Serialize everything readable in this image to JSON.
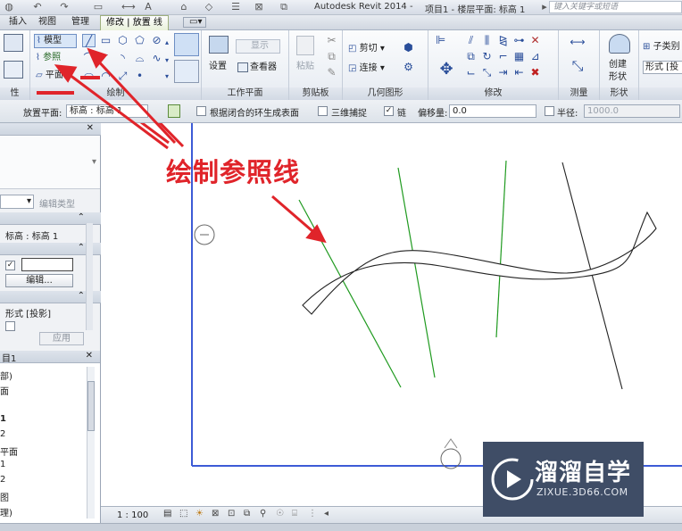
{
  "titlebar": {
    "app_title": "Autodesk Revit 2014 -",
    "doc_title": "项目1 - 楼层平面: 标高 1",
    "search_placeholder": "键入关键字或短语"
  },
  "tabs": [
    {
      "label": "插入",
      "active": false
    },
    {
      "label": "视图",
      "active": false
    },
    {
      "label": "管理",
      "active": false
    },
    {
      "label": "修改 | 放置 线",
      "active": true
    }
  ],
  "ribbon": {
    "props_panel_label": "性",
    "draw_panel_label": "绘制",
    "draw": {
      "model": "模型",
      "reference": "参照",
      "plane": "平面"
    },
    "workplane": {
      "label": "工作平面",
      "set": "设置",
      "show": "显示",
      "viewer": "查看器"
    },
    "clipboard": {
      "label": "剪贴板",
      "paste": "粘贴"
    },
    "geometry": {
      "label": "几何图形",
      "cut": "剪切",
      "join": "连接"
    },
    "modify": {
      "label": "修改"
    },
    "measure": {
      "label": "测量"
    },
    "form": {
      "label": "形状",
      "create": "创建",
      "shape": "形状"
    },
    "subcat": {
      "label1": "子类别",
      "label2": "形式 [投"
    }
  },
  "options_bar": {
    "placement_plane_label": "放置平面:",
    "placement_plane_value": "标高 : 标高 1",
    "closed_loop_label": "根据闭合的环生成表面",
    "snap3d_label": "三维捕捉",
    "chain_label": "链",
    "chain_checked": true,
    "offset_label": "偏移量:",
    "offset_value": "0.0",
    "radius_label": "半径:",
    "radius_value": "1000.0"
  },
  "properties": {
    "edit_type": "编辑类型",
    "level_value": "标高 : 标高 1",
    "edit_button": "编辑...",
    "form_label": "形式 [投影]",
    "apply_button": "应用"
  },
  "browser": {
    "title": "目1",
    "items": [
      "部)",
      "面",
      "",
      "1",
      "2",
      "平面",
      "1",
      "2",
      "图",
      "理)"
    ]
  },
  "viewbar": {
    "scale": "1 : 100"
  },
  "annotation": {
    "text": "绘制参照线"
  },
  "watermark": {
    "name": "溜溜自学",
    "url": "ZIXUE.3D66.COM"
  },
  "colors": {
    "annotation_red": "#e0242a",
    "reference_green": "#1f9a1f",
    "view_border_blue": "#3d5bd6",
    "watermark_bg": "#3f4d66"
  }
}
